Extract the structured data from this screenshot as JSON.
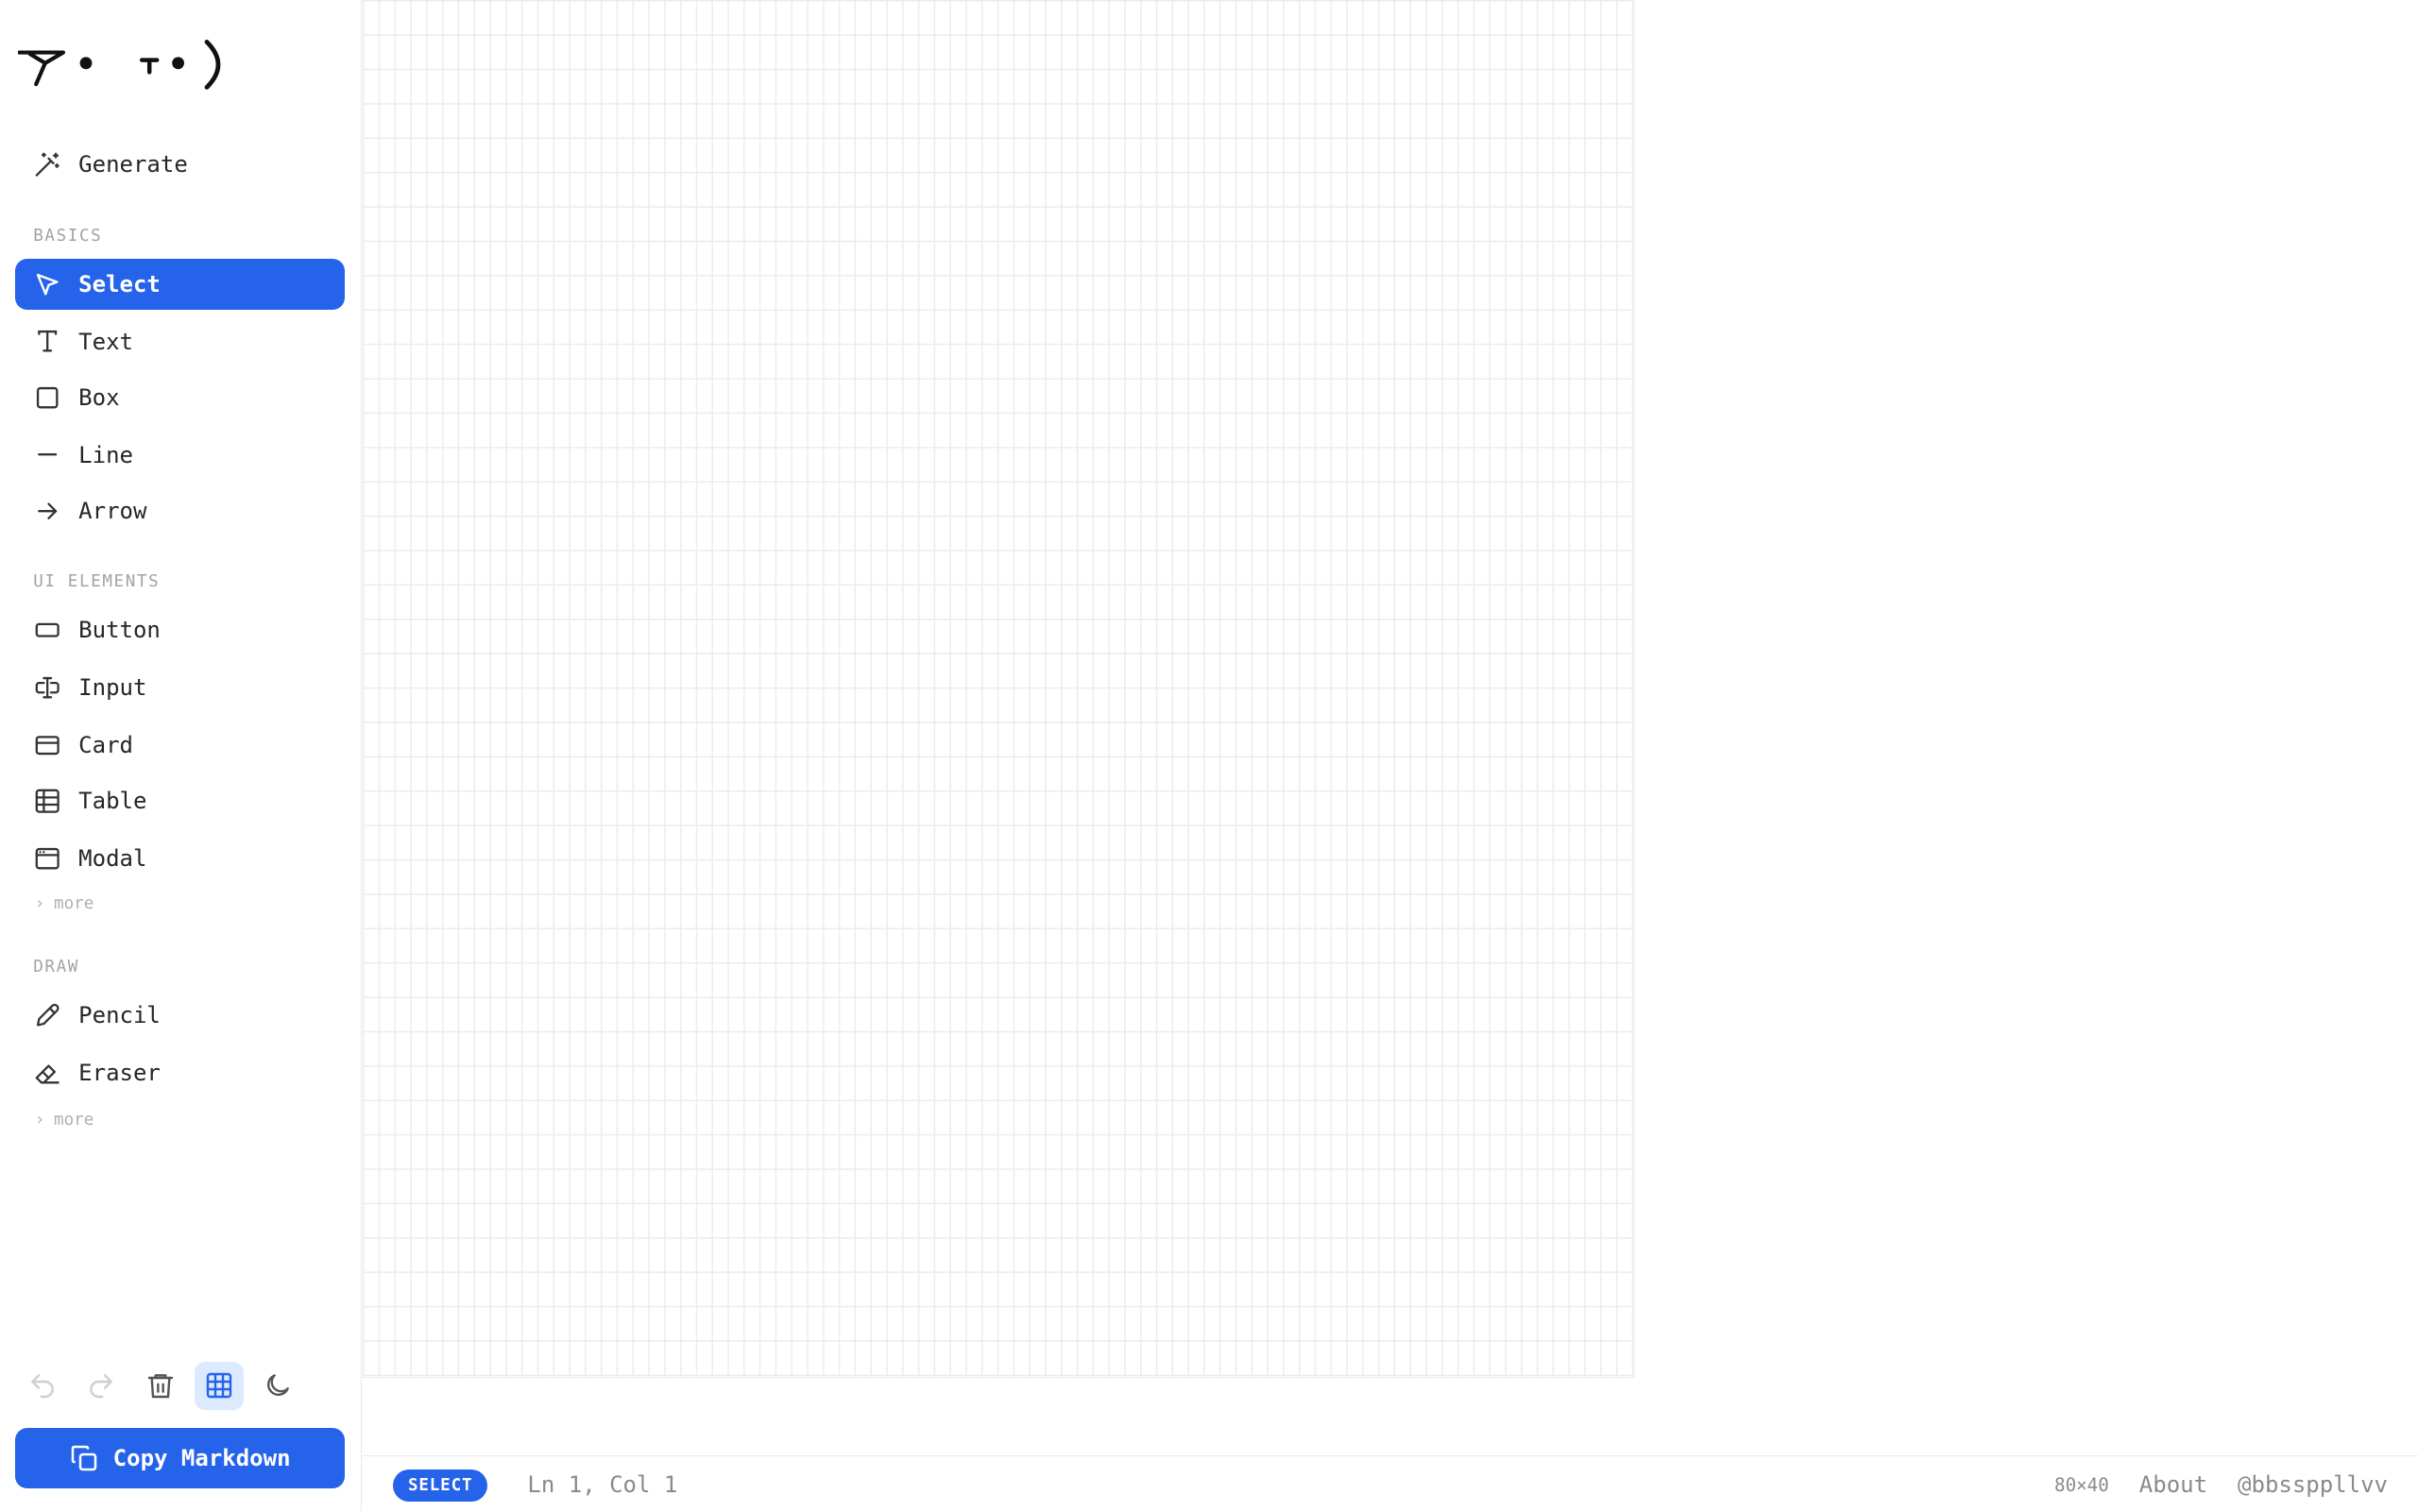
{
  "sidebar": {
    "generate_label": "Generate",
    "sections": {
      "basics": "BASICS",
      "ui_elements": "UI ELEMENTS",
      "draw": "DRAW"
    },
    "basics_tools": [
      {
        "label": "Select",
        "icon": "cursor-icon",
        "active": true
      },
      {
        "label": "Text",
        "icon": "text-icon"
      },
      {
        "label": "Box",
        "icon": "square-icon"
      },
      {
        "label": "Line",
        "icon": "minus-icon"
      },
      {
        "label": "Arrow",
        "icon": "arrow-right-icon"
      }
    ],
    "ui_tools": [
      {
        "label": "Button",
        "icon": "button-icon"
      },
      {
        "label": "Input",
        "icon": "text-cursor-input-icon"
      },
      {
        "label": "Card",
        "icon": "credit-card-icon"
      },
      {
        "label": "Table",
        "icon": "table-icon"
      },
      {
        "label": "Modal",
        "icon": "app-window-icon"
      }
    ],
    "draw_tools": [
      {
        "label": "Pencil",
        "icon": "pencil-icon"
      },
      {
        "label": "Eraser",
        "icon": "eraser-icon"
      }
    ],
    "more_label": "more",
    "copy_label": "Copy Markdown",
    "accent_color": "#2563eb"
  },
  "status": {
    "mode": "SELECT",
    "cursor": "Ln 1, Col 1",
    "grid_size": "80×40",
    "about": "About",
    "author": "@bbssppllvv"
  }
}
